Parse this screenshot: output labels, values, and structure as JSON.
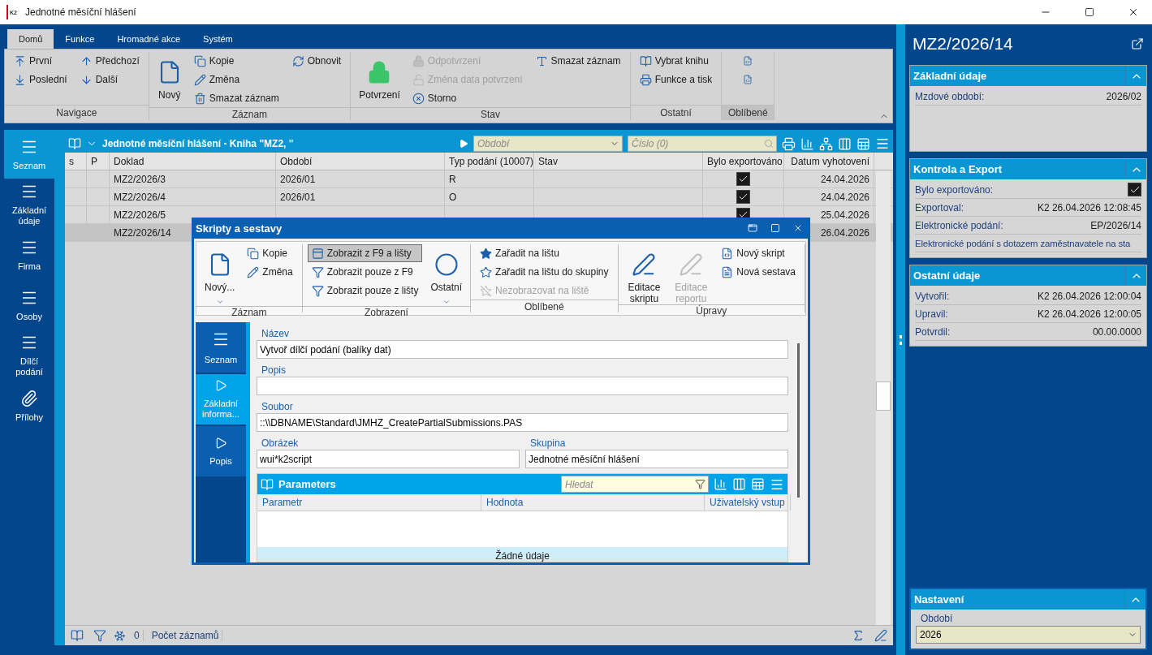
{
  "window": {
    "logo": "K2",
    "title": "Jednotné měsíční hlášení"
  },
  "ribbon": {
    "tabs": [
      {
        "label": "Domů",
        "selected": true
      },
      {
        "label": "Funkce",
        "selected": false
      },
      {
        "label": "Hromadné akce",
        "selected": false
      },
      {
        "label": "Systém",
        "selected": false
      }
    ],
    "groups": [
      {
        "label": "Navigace",
        "highlighted": false,
        "columns": [
          [
            {
              "kind": "small",
              "label": "První",
              "disabled": false
            },
            {
              "kind": "small",
              "label": "Poslední",
              "disabled": false
            }
          ],
          [
            {
              "kind": "small",
              "label": "Předchozí",
              "disabled": false
            },
            {
              "kind": "small",
              "label": "Další",
              "disabled": false
            }
          ]
        ]
      },
      {
        "label": "Záznam",
        "highlighted": false,
        "columns": [
          [
            {
              "kind": "large",
              "label": "Nový",
              "disabled": false,
              "dropdown": false
            }
          ],
          [
            {
              "kind": "small",
              "label": "Kopie",
              "disabled": false
            },
            {
              "kind": "small",
              "label": "Změna",
              "disabled": false
            },
            {
              "kind": "small",
              "label": "Smazat záznam",
              "disabled": false
            }
          ],
          [
            {
              "kind": "small",
              "label": "Obnovit",
              "disabled": false
            }
          ]
        ]
      },
      {
        "label": "Stav",
        "highlighted": false,
        "columns": [
          [
            {
              "kind": "large",
              "label": "Potvrzení",
              "disabled": false,
              "dropdown": false
            }
          ],
          [
            {
              "kind": "small",
              "label": "Odpotvrzení",
              "disabled": true
            },
            {
              "kind": "small",
              "label": "Změna data potvrzení",
              "disabled": true
            },
            {
              "kind": "small",
              "label": "Storno",
              "disabled": false
            }
          ],
          [
            {
              "kind": "small",
              "label": "Smazat záznam",
              "disabled": false
            }
          ]
        ]
      },
      {
        "label": "Ostatní",
        "highlighted": false,
        "columns": [
          [
            {
              "kind": "small",
              "label": "Vybrat knihu",
              "disabled": false
            },
            {
              "kind": "small",
              "label": "Funkce a tisk",
              "disabled": false
            }
          ]
        ]
      },
      {
        "label": "Oblíbené",
        "highlighted": true,
        "columns": [
          [
            {
              "kind": "icon",
              "disabled": false
            },
            {
              "kind": "icon",
              "disabled": false
            }
          ]
        ]
      }
    ]
  },
  "sidebar": {
    "items": [
      {
        "label": "Seznam",
        "selected": true
      },
      {
        "label": "Základní údaje",
        "selected": false
      },
      {
        "label": "Firma",
        "selected": false
      },
      {
        "label": "Osoby",
        "selected": false
      },
      {
        "label": "Dílčí podání",
        "selected": false
      },
      {
        "label": "Přílohy",
        "selected": false
      }
    ]
  },
  "table": {
    "title": "Jednotné měsíční hlášení - Kniha \"MZ2, \"",
    "period_filter": {
      "placeholder": "Období"
    },
    "number_filter": {
      "placeholder": "Číslo (0)"
    },
    "columns": [
      "s",
      "P",
      "Doklad",
      "Období",
      "Typ podání (10007)",
      "Stav",
      "Bylo exportováno",
      "Datum vyhotovení"
    ],
    "rows": [
      {
        "selected": false,
        "doklad": "MZ2/2026/3",
        "obdobi": "2026/01",
        "typ": "R",
        "exported": true,
        "datum": "24.04.2026"
      },
      {
        "selected": false,
        "doklad": "MZ2/2026/4",
        "obdobi": "2026/01",
        "typ": "O",
        "exported": true,
        "datum": "24.04.2026"
      },
      {
        "selected": false,
        "doklad": "MZ2/2026/5",
        "exported": true,
        "datum": "25.04.2026"
      },
      {
        "selected": true,
        "doklad": "MZ2/2026/14",
        "datum": "26.04.2026"
      }
    ],
    "status": {
      "count": "0",
      "count_label": "Počet záznamů"
    }
  },
  "detail": {
    "title": "MZ2/2026/14",
    "sections": [
      {
        "title": "Základní údaje",
        "expanded": true,
        "rows": [
          {
            "kind": "value",
            "label": "Mzdové období:",
            "value": "2026/02"
          }
        ]
      },
      {
        "title": "Kontrola a Export",
        "expanded": true,
        "rows": [
          {
            "kind": "check",
            "label": "Bylo exportováno:",
            "checked": true
          },
          {
            "kind": "value",
            "label": "Exportoval:",
            "value": "K2 26.04.2026 12:08:45"
          },
          {
            "kind": "value",
            "label": "Elektronické podání:",
            "value": "EP/2026/14"
          },
          {
            "kind": "note",
            "label": "Elektronické podání s dotazem zaměstnavatele na sta"
          }
        ]
      },
      {
        "title": "Ostatní údaje",
        "expanded": true,
        "rows": [
          {
            "kind": "value",
            "label": "Vytvořil:",
            "value": "K2 26.04.2026 12:00:04"
          },
          {
            "kind": "value",
            "label": "Upravil:",
            "value": "K2 26.04.2026 12:00:05"
          },
          {
            "kind": "value",
            "label": "Potvrdil:",
            "value": "00.00.0000"
          }
        ]
      }
    ],
    "settings": {
      "title": "Nastavení",
      "expanded": true,
      "field_label": "Období",
      "value": "2026"
    }
  },
  "dialog": {
    "title": "Skripty a sestavy",
    "groups": [
      {
        "label": "Záznam",
        "highlighted": false,
        "columns": [
          [
            {
              "kind": "large",
              "label": "Nový...",
              "disabled": false,
              "dropdown": true
            }
          ],
          [
            {
              "kind": "small",
              "label": "Kopie",
              "disabled": false
            },
            {
              "kind": "small",
              "label": "Změna",
              "disabled": false
            }
          ]
        ]
      },
      {
        "label": "Zobrazení",
        "highlighted": false,
        "columns": [
          [
            {
              "kind": "small",
              "label": "Zobrazit z F9 a lišty",
              "disabled": false,
              "pressed": true
            },
            {
              "kind": "small",
              "label": "Zobrazit pouze z F9",
              "disabled": false,
              "pressed": false
            },
            {
              "kind": "small",
              "label": "Zobrazit pouze z lišty",
              "disabled": false,
              "pressed": false
            }
          ],
          [
            {
              "kind": "large",
              "label": "Ostatní",
              "disabled": false,
              "dropdown": true
            }
          ]
        ]
      },
      {
        "label": "Oblíbené",
        "highlighted": false,
        "columns": [
          [
            {
              "kind": "small",
              "label": "Zařadit na lištu",
              "disabled": false
            },
            {
              "kind": "small",
              "label": "Zařadit na lištu do skupiny",
              "disabled": false
            },
            {
              "kind": "small",
              "label": "Nezobrazovat na liště",
              "disabled": true
            }
          ]
        ]
      },
      {
        "label": "Úpravy",
        "highlighted": false,
        "columns": [
          [
            {
              "kind": "large",
              "label": "Editace skriptu",
              "disabled": false,
              "dropdown": false
            }
          ],
          [
            {
              "kind": "large",
              "label": "Editace reportu",
              "disabled": true,
              "dropdown": false
            }
          ],
          [
            {
              "kind": "small",
              "label": "Nový skript",
              "disabled": false
            },
            {
              "kind": "small",
              "label": "Nová sestava",
              "disabled": false
            }
          ]
        ]
      }
    ],
    "sidebar": [
      {
        "label": "Seznam",
        "selected": false
      },
      {
        "label": "Základní informa...",
        "selected": true
      },
      {
        "label": "Popis",
        "selected": false
      }
    ],
    "fields": {
      "name": {
        "label": "Název",
        "value": "Vytvoř dílčí podání (balíky dat)"
      },
      "description": {
        "label": "Popis"
      },
      "file": {
        "label": "Soubor",
        "value": "::\\\\DBNAME\\Standard\\JMHZ_CreatePartialSubmissions.PAS"
      },
      "image": {
        "label": "Obrázek",
        "value": "wui*k2script"
      },
      "group": {
        "label": "Skupina",
        "value": "Jednotné měsíční hlášení"
      }
    },
    "parameters": {
      "title": "Parameters",
      "search": {
        "placeholder": "Hledat"
      },
      "columns": [
        "Parametr",
        "Hodnota",
        "Uživatelský vstup"
      ],
      "empty": "Žádné údaje"
    }
  }
}
